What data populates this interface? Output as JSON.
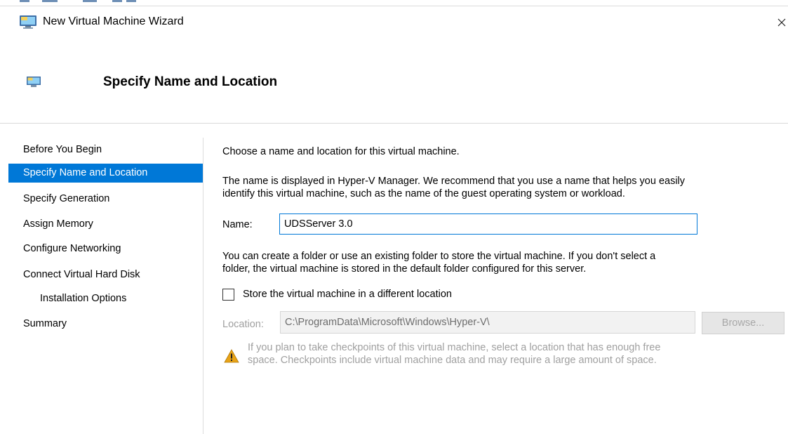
{
  "window": {
    "title": "New Virtual Machine Wizard",
    "close_glyph": "×",
    "app_icon": "hyper-v-monitor-icon"
  },
  "header": {
    "title": "Specify Name and Location",
    "icon": "hyper-v-monitor-icon"
  },
  "nav": {
    "items": [
      {
        "label": "Before You Begin"
      },
      {
        "label": "Specify Name and Location"
      },
      {
        "label": "Specify Generation"
      },
      {
        "label": "Assign Memory"
      },
      {
        "label": "Configure Networking"
      },
      {
        "label": "Connect Virtual Hard Disk"
      },
      {
        "label": "Installation Options"
      },
      {
        "label": "Summary"
      }
    ],
    "selected_index": 1
  },
  "content": {
    "intro": "Choose a name and location for this virtual machine.",
    "name_help_line1": "The name is displayed in Hyper-V Manager. We recommend that you use a name that helps you easily",
    "name_help_line2": "identify this virtual machine, such as the name of the guest operating system or workload.",
    "name_label": "Name:",
    "name_value": "UDSServer 3.0",
    "folder_help_line1": "You can create a folder or use an existing folder to store the virtual machine. If you don't select a",
    "folder_help_line2": "folder, the virtual machine is stored in the default folder configured for this server.",
    "store_checkbox_label": "Store the virtual machine in a different location",
    "store_checkbox_checked": false,
    "location_label": "Location:",
    "location_value": "C:\\ProgramData\\Microsoft\\Windows\\Hyper-V\\",
    "browse_label": "Browse...",
    "warning_line1": "If you plan to take checkpoints of this virtual machine, select a location that has enough free",
    "warning_line2": "space. Checkpoints include virtual machine data and may require a large amount of space."
  },
  "colors": {
    "accent": "#0078d7",
    "disabled_text": "#a0a0a0",
    "warning": "#e8a317"
  }
}
